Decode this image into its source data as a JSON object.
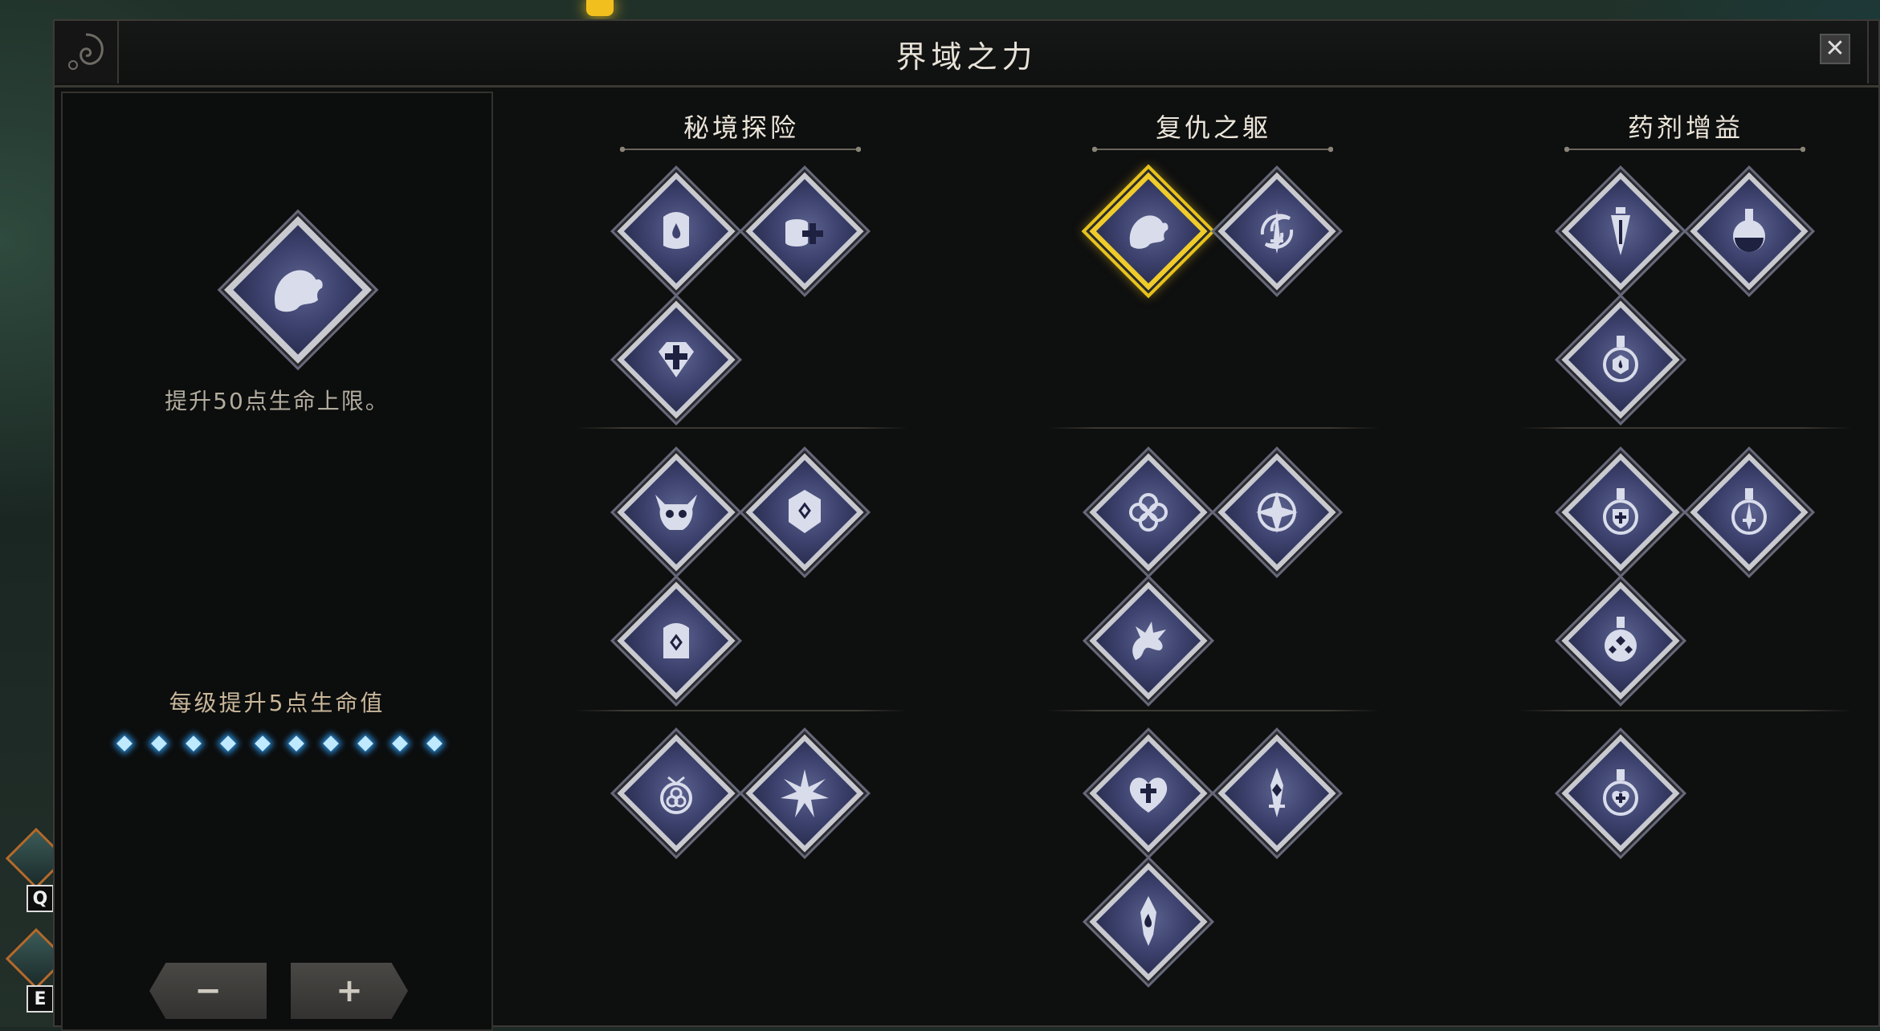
{
  "window": {
    "title": "界域之力",
    "close_label": "✕"
  },
  "detail": {
    "selected_skill_icon": "hound-head-icon",
    "description": "提升50点生命上限。",
    "per_level": "每级提升5点生命值",
    "level_pips_total": 10,
    "level_pips_filled": 10,
    "minus_label": "−",
    "plus_label": "+"
  },
  "columns": [
    {
      "title": "秘境探险",
      "tiers": [
        [
          "drop-shield-icon",
          "coin-stack-plus-icon",
          "gem-cross-icon"
        ],
        [
          "horned-skull-icon",
          "rune-gem-icon",
          "rune-tablet-icon"
        ],
        [
          "triquetra-amulet-icon",
          "star-burst-icon"
        ]
      ]
    },
    {
      "title": "复仇之躯",
      "tiers": [
        [
          "hound-head-icon",
          "swirl-sword-icon"
        ],
        [
          "knot-icon",
          "compass-star-icon",
          "dragon-head-icon"
        ],
        [
          "heart-cross-icon",
          "crystal-blade-icon",
          "flame-blade-icon"
        ]
      ]
    },
    {
      "title": "药剂增益",
      "tiers": [
        [
          "potion-dagger-icon",
          "round-flask-icon",
          "potion-drop-icon"
        ],
        [
          "potion-shield-icon",
          "potion-sword-icon",
          "potion-gems-icon"
        ],
        [
          "potion-heart-icon"
        ]
      ]
    }
  ],
  "hotkeys": {
    "q": "Q",
    "e": "E"
  },
  "colors": {
    "selected_border": "#e6c21c",
    "pip_glow": "#2a8bd6",
    "icon_fill": "#3e4370"
  }
}
